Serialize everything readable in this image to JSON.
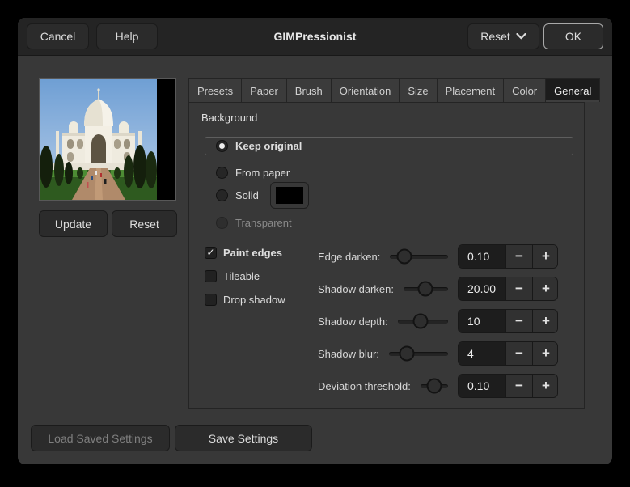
{
  "window": {
    "title": "GIMPressionist"
  },
  "header": {
    "cancel_label": "Cancel",
    "help_label": "Help",
    "reset_label": "Reset",
    "ok_label": "OK"
  },
  "preview": {
    "image_alt": "Taj Mahal photo preview",
    "update_label": "Update",
    "reset_label": "Reset"
  },
  "tabs": [
    {
      "label": "Presets",
      "active": false
    },
    {
      "label": "Paper",
      "active": false
    },
    {
      "label": "Brush",
      "active": false
    },
    {
      "label": "Orientation",
      "active": false
    },
    {
      "label": "Size",
      "active": false
    },
    {
      "label": "Placement",
      "active": false
    },
    {
      "label": "Color",
      "active": false
    },
    {
      "label": "General",
      "active": true
    }
  ],
  "general": {
    "section_title": "Background",
    "radios": [
      {
        "label": "Keep original",
        "selected": true,
        "disabled": false
      },
      {
        "label": "From paper",
        "selected": false,
        "disabled": false
      },
      {
        "label": "Solid",
        "selected": false,
        "disabled": false,
        "swatch_color": "#000000"
      },
      {
        "label": "Transparent",
        "selected": false,
        "disabled": true
      }
    ],
    "checkboxes": [
      {
        "label": "Paint edges",
        "checked": true
      },
      {
        "label": "Tileable",
        "checked": false
      },
      {
        "label": "Drop shadow",
        "checked": false
      }
    ],
    "sliders": [
      {
        "label": "Edge darken:",
        "value": "0.10"
      },
      {
        "label": "Shadow darken:",
        "value": "20.00"
      },
      {
        "label": "Shadow depth:",
        "value": "10"
      },
      {
        "label": "Shadow blur:",
        "value": "4"
      },
      {
        "label": "Deviation threshold:",
        "value": "0.10"
      }
    ],
    "spin_minus": "−",
    "spin_plus": "+"
  },
  "footer": {
    "load_label": "Load Saved Settings",
    "load_disabled": true,
    "save_label": "Save Settings"
  },
  "icons": {
    "reset_menu": "chevron-down-icon",
    "checkbox_check": "✓"
  },
  "colors": {
    "window_bg": "#000000",
    "dialog_bg": "#383838",
    "header_bg": "#242424",
    "button_bg": "#2b2b2b",
    "entry_bg": "#1d1d1d",
    "active_tab_bg": "#1c1c1c",
    "text": "#e6e6e6",
    "disabled_text": "#858585",
    "solid_swatch": "#000000"
  }
}
